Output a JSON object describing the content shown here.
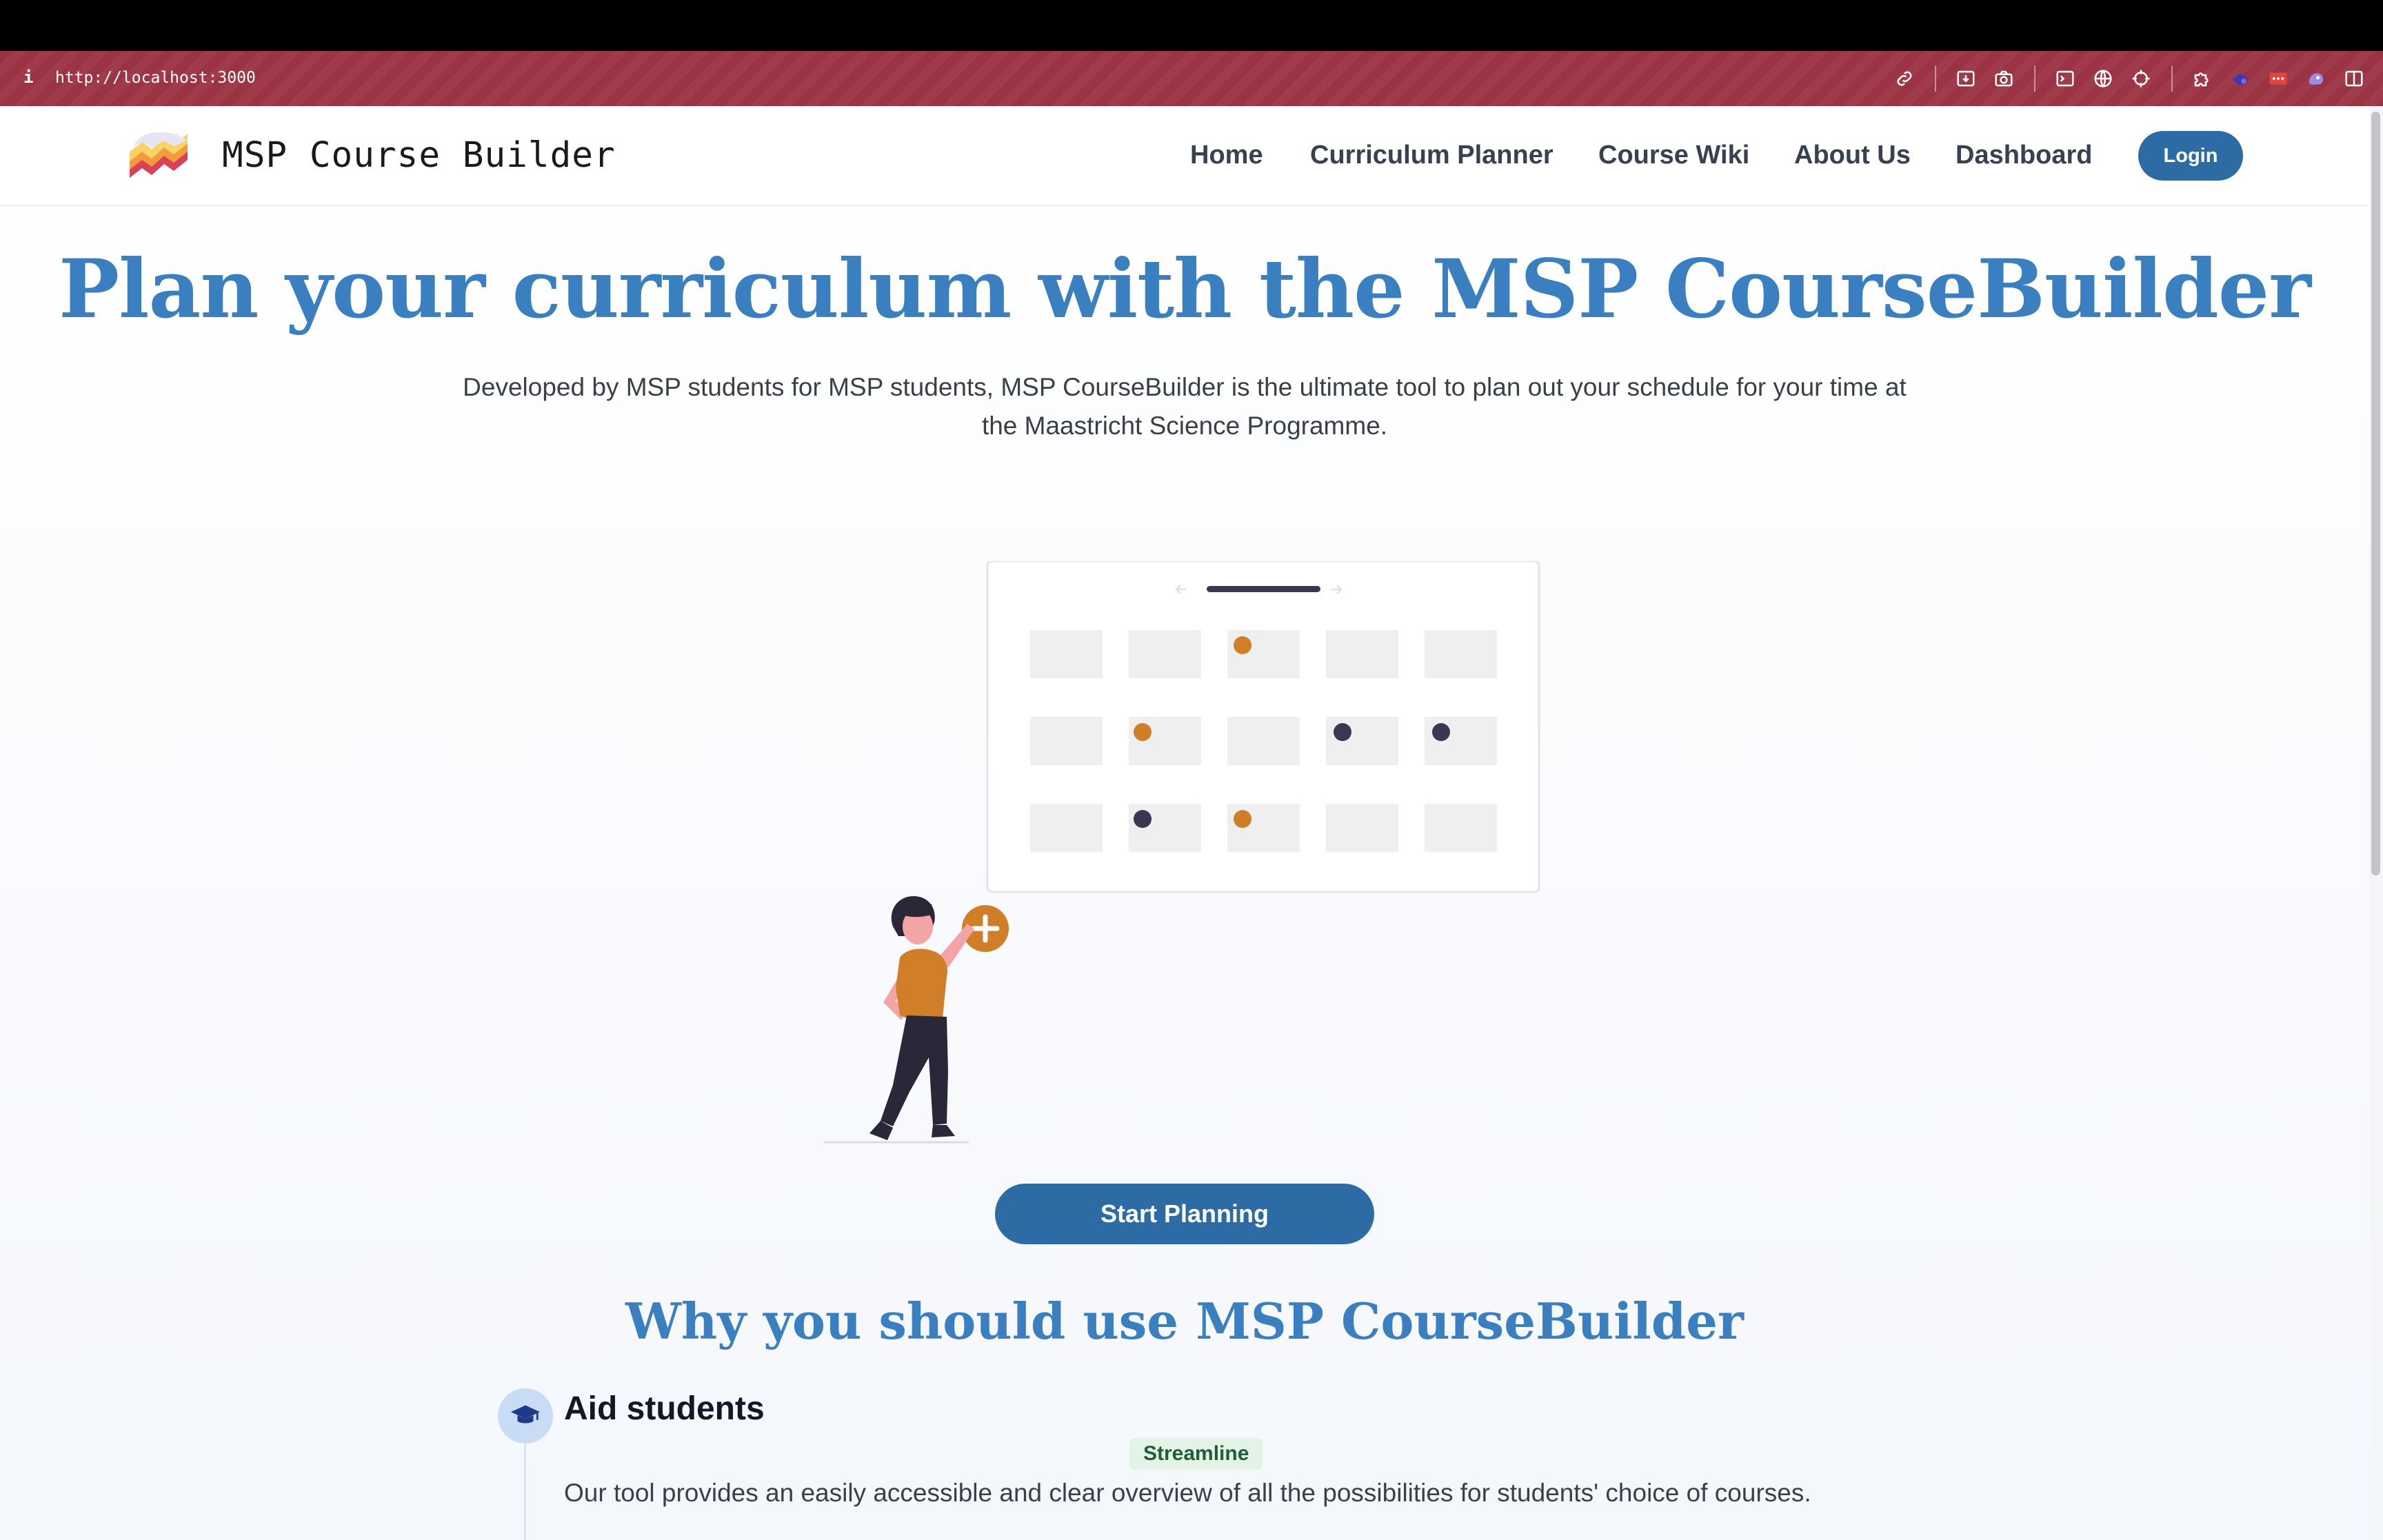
{
  "browser": {
    "info_icon": "i",
    "url": "http://localhost:3000",
    "toolbar_icons": [
      "link-icon",
      "download-icon",
      "camera-icon",
      "terminal-icon",
      "globe-icon",
      "crosshair-icon",
      "puzzle-icon",
      "extension-icon",
      "extension-icon",
      "extension-icon",
      "sidebar-icon"
    ]
  },
  "navbar": {
    "brand": "MSP Course Builder",
    "links": [
      "Home",
      "Curriculum Planner",
      "Course Wiki",
      "About Us",
      "Dashboard"
    ],
    "login_label": "Login"
  },
  "hero": {
    "title": "Plan your curriculum with the MSP CourseBuilder",
    "subtitle": "Developed by MSP students for MSP students, MSP CourseBuilder is the ultimate tool to plan out your schedule for your time at the Maastricht Science Programme.",
    "cta_label": "Start Planning"
  },
  "why": {
    "title": "Why you should use MSP CourseBuilder",
    "features": [
      {
        "icon": "graduation-cap-icon",
        "title": "Aid students",
        "badge": "Streamline",
        "text": "Our tool provides an easily accessible and clear overview of all the possibilities for students' choice of courses."
      }
    ]
  },
  "colors": {
    "primary": "#2c6ba3",
    "heading": "#3a7fc0",
    "accent": "#d07e28",
    "dark": "#3a3750",
    "browser_bar": "#9a3445"
  }
}
